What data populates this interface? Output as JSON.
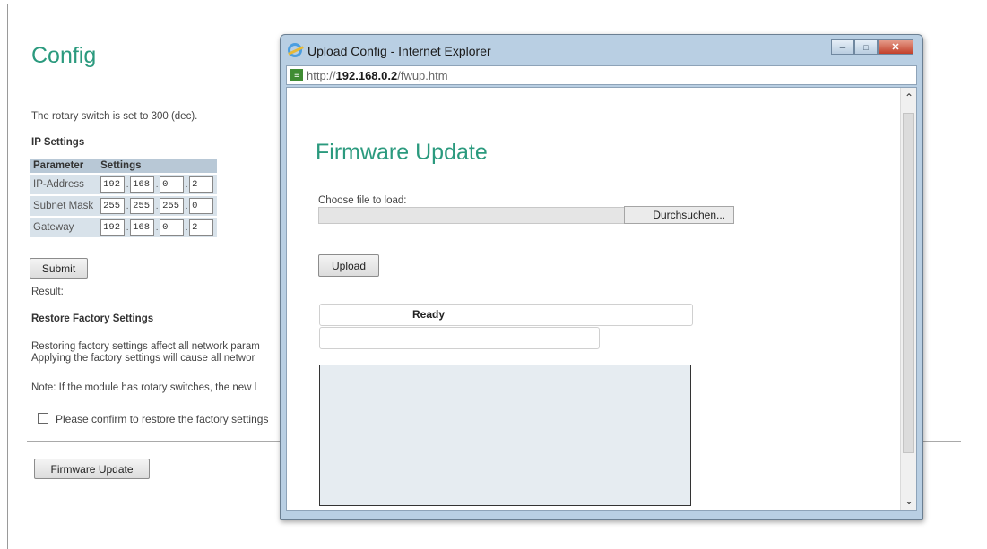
{
  "config_page": {
    "title": "Config",
    "rotary_text": "The rotary switch is set to 300 (dec).",
    "ip_settings_heading": "IP Settings",
    "table": {
      "headers": [
        "Parameter",
        "Settings"
      ],
      "rows": [
        {
          "label": "IP-Address",
          "octets": [
            "192",
            "168",
            "0",
            "2"
          ]
        },
        {
          "label": "Subnet Mask",
          "octets": [
            "255",
            "255",
            "255",
            "0"
          ]
        },
        {
          "label": "Gateway",
          "octets": [
            "192",
            "168",
            "0",
            "2"
          ]
        }
      ]
    },
    "submit_label": "Submit",
    "result_label": "Result:",
    "restore_heading": "Restore Factory Settings",
    "restore_line1": "Restoring factory settings affect all network param",
    "restore_line2": "Applying the factory settings will cause all networ",
    "note_text": "Note: If the module has rotary switches, the new l",
    "confirm_label": "Please confirm to restore the factory settings",
    "firmware_update_button": "Firmware Update"
  },
  "popup": {
    "window_title": "Upload Config - Internet Explorer",
    "address": {
      "prefix": "http://",
      "host": "192.168.0.2",
      "path": "/fwup.htm"
    },
    "heading": "Firmware Update",
    "choose_file_label": "Choose file to load:",
    "browse_label": "Durchsuchen...",
    "upload_label": "Upload",
    "status_text": "Ready",
    "icons": [
      "ie-logo-icon",
      "page-icon",
      "minimize-icon",
      "maximize-icon",
      "close-icon",
      "scroll-up-icon",
      "scroll-down-icon"
    ]
  },
  "colors": {
    "heading_accent": "#2b9a7e",
    "table_header": "#b8c8d6",
    "table_row": "#d8e2ea",
    "window_chrome": "#b9cfe3",
    "log_area": "#e6ecf1"
  }
}
